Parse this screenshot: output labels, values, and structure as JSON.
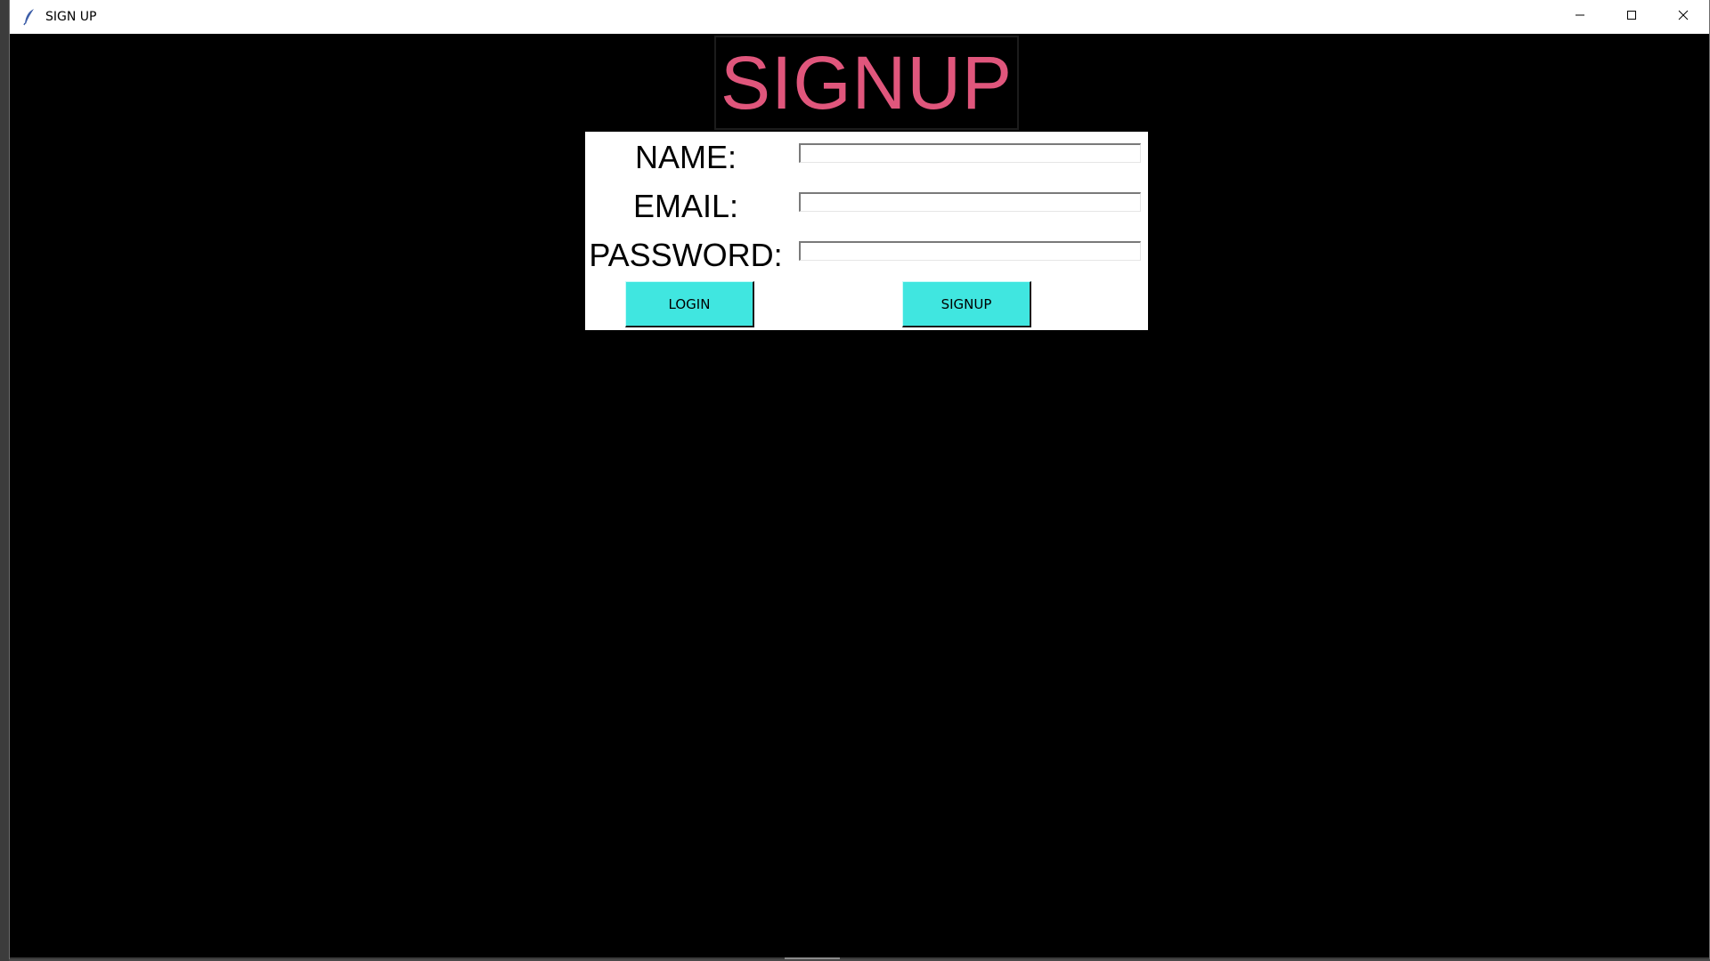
{
  "window": {
    "title": "SIGN UP",
    "app_icon": "feather-icon",
    "controls": {
      "minimize_icon": "minimize-icon",
      "maximize_icon": "maximize-icon",
      "close_icon": "close-icon"
    }
  },
  "heading": {
    "text": "SIGNUP",
    "color": "#e0567c"
  },
  "form": {
    "fields": [
      {
        "label": "NAME:",
        "value": ""
      },
      {
        "label": "EMAIL:",
        "value": ""
      },
      {
        "label": "PASSWORD:",
        "value": ""
      }
    ],
    "buttons": {
      "login_label": "LOGIN",
      "signup_label": "SIGNUP",
      "color": "#40e6e0"
    }
  }
}
